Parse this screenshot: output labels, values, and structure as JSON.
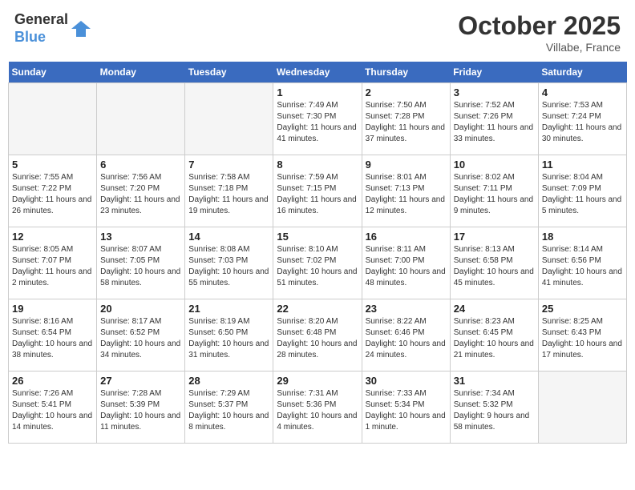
{
  "header": {
    "logo_general": "General",
    "logo_blue": "Blue",
    "month_title": "October 2025",
    "location": "Villabe, France"
  },
  "days_of_week": [
    "Sunday",
    "Monday",
    "Tuesday",
    "Wednesday",
    "Thursday",
    "Friday",
    "Saturday"
  ],
  "weeks": [
    [
      {
        "day": "",
        "info": ""
      },
      {
        "day": "",
        "info": ""
      },
      {
        "day": "",
        "info": ""
      },
      {
        "day": "1",
        "info": "Sunrise: 7:49 AM\nSunset: 7:30 PM\nDaylight: 11 hours and 41 minutes."
      },
      {
        "day": "2",
        "info": "Sunrise: 7:50 AM\nSunset: 7:28 PM\nDaylight: 11 hours and 37 minutes."
      },
      {
        "day": "3",
        "info": "Sunrise: 7:52 AM\nSunset: 7:26 PM\nDaylight: 11 hours and 33 minutes."
      },
      {
        "day": "4",
        "info": "Sunrise: 7:53 AM\nSunset: 7:24 PM\nDaylight: 11 hours and 30 minutes."
      }
    ],
    [
      {
        "day": "5",
        "info": "Sunrise: 7:55 AM\nSunset: 7:22 PM\nDaylight: 11 hours and 26 minutes."
      },
      {
        "day": "6",
        "info": "Sunrise: 7:56 AM\nSunset: 7:20 PM\nDaylight: 11 hours and 23 minutes."
      },
      {
        "day": "7",
        "info": "Sunrise: 7:58 AM\nSunset: 7:18 PM\nDaylight: 11 hours and 19 minutes."
      },
      {
        "day": "8",
        "info": "Sunrise: 7:59 AM\nSunset: 7:15 PM\nDaylight: 11 hours and 16 minutes."
      },
      {
        "day": "9",
        "info": "Sunrise: 8:01 AM\nSunset: 7:13 PM\nDaylight: 11 hours and 12 minutes."
      },
      {
        "day": "10",
        "info": "Sunrise: 8:02 AM\nSunset: 7:11 PM\nDaylight: 11 hours and 9 minutes."
      },
      {
        "day": "11",
        "info": "Sunrise: 8:04 AM\nSunset: 7:09 PM\nDaylight: 11 hours and 5 minutes."
      }
    ],
    [
      {
        "day": "12",
        "info": "Sunrise: 8:05 AM\nSunset: 7:07 PM\nDaylight: 11 hours and 2 minutes."
      },
      {
        "day": "13",
        "info": "Sunrise: 8:07 AM\nSunset: 7:05 PM\nDaylight: 10 hours and 58 minutes."
      },
      {
        "day": "14",
        "info": "Sunrise: 8:08 AM\nSunset: 7:03 PM\nDaylight: 10 hours and 55 minutes."
      },
      {
        "day": "15",
        "info": "Sunrise: 8:10 AM\nSunset: 7:02 PM\nDaylight: 10 hours and 51 minutes."
      },
      {
        "day": "16",
        "info": "Sunrise: 8:11 AM\nSunset: 7:00 PM\nDaylight: 10 hours and 48 minutes."
      },
      {
        "day": "17",
        "info": "Sunrise: 8:13 AM\nSunset: 6:58 PM\nDaylight: 10 hours and 45 minutes."
      },
      {
        "day": "18",
        "info": "Sunrise: 8:14 AM\nSunset: 6:56 PM\nDaylight: 10 hours and 41 minutes."
      }
    ],
    [
      {
        "day": "19",
        "info": "Sunrise: 8:16 AM\nSunset: 6:54 PM\nDaylight: 10 hours and 38 minutes."
      },
      {
        "day": "20",
        "info": "Sunrise: 8:17 AM\nSunset: 6:52 PM\nDaylight: 10 hours and 34 minutes."
      },
      {
        "day": "21",
        "info": "Sunrise: 8:19 AM\nSunset: 6:50 PM\nDaylight: 10 hours and 31 minutes."
      },
      {
        "day": "22",
        "info": "Sunrise: 8:20 AM\nSunset: 6:48 PM\nDaylight: 10 hours and 28 minutes."
      },
      {
        "day": "23",
        "info": "Sunrise: 8:22 AM\nSunset: 6:46 PM\nDaylight: 10 hours and 24 minutes."
      },
      {
        "day": "24",
        "info": "Sunrise: 8:23 AM\nSunset: 6:45 PM\nDaylight: 10 hours and 21 minutes."
      },
      {
        "day": "25",
        "info": "Sunrise: 8:25 AM\nSunset: 6:43 PM\nDaylight: 10 hours and 17 minutes."
      }
    ],
    [
      {
        "day": "26",
        "info": "Sunrise: 7:26 AM\nSunset: 5:41 PM\nDaylight: 10 hours and 14 minutes."
      },
      {
        "day": "27",
        "info": "Sunrise: 7:28 AM\nSunset: 5:39 PM\nDaylight: 10 hours and 11 minutes."
      },
      {
        "day": "28",
        "info": "Sunrise: 7:29 AM\nSunset: 5:37 PM\nDaylight: 10 hours and 8 minutes."
      },
      {
        "day": "29",
        "info": "Sunrise: 7:31 AM\nSunset: 5:36 PM\nDaylight: 10 hours and 4 minutes."
      },
      {
        "day": "30",
        "info": "Sunrise: 7:33 AM\nSunset: 5:34 PM\nDaylight: 10 hours and 1 minute."
      },
      {
        "day": "31",
        "info": "Sunrise: 7:34 AM\nSunset: 5:32 PM\nDaylight: 9 hours and 58 minutes."
      },
      {
        "day": "",
        "info": ""
      }
    ]
  ]
}
